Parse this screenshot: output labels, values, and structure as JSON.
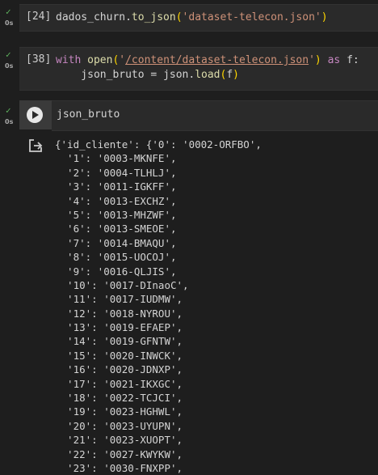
{
  "cells": [
    {
      "status": "✓",
      "time": "0s",
      "exec_count": "[24]",
      "code_lines": [
        [
          {
            "t": "dados_churn",
            "c": "plain"
          },
          {
            "t": ".",
            "c": "plain"
          },
          {
            "t": "to_json",
            "c": "fn"
          },
          {
            "t": "(",
            "c": "paren"
          },
          {
            "t": "'dataset-telecon.json'",
            "c": "str"
          },
          {
            "t": ")",
            "c": "paren"
          }
        ]
      ]
    },
    {
      "status": "✓",
      "time": "0s",
      "exec_count": "[38]",
      "code_lines": [
        [
          {
            "t": "with ",
            "c": "kw"
          },
          {
            "t": "open",
            "c": "fn"
          },
          {
            "t": "(",
            "c": "paren"
          },
          {
            "t": "'",
            "c": "str"
          },
          {
            "t": "/content/dataset-telecon.json",
            "c": "url"
          },
          {
            "t": "'",
            "c": "str"
          },
          {
            "t": ") ",
            "c": "paren"
          },
          {
            "t": "as ",
            "c": "kw"
          },
          {
            "t": "f:",
            "c": "plain"
          }
        ],
        [
          {
            "t": "    json_bruto ",
            "c": "plain"
          },
          {
            "t": "= ",
            "c": "plain"
          },
          {
            "t": "json",
            "c": "plain"
          },
          {
            "t": ".",
            "c": "plain"
          },
          {
            "t": "load",
            "c": "fn"
          },
          {
            "t": "(",
            "c": "paren"
          },
          {
            "t": "f",
            "c": "plain"
          },
          {
            "t": ")",
            "c": "paren"
          }
        ]
      ]
    },
    {
      "status": "✓",
      "time": "0s",
      "code": "json_bruto"
    }
  ],
  "output_lines": [
    "{'id_cliente': {'0': '0002-ORFBO',",
    "  '1': '0003-MKNFE',",
    "  '2': '0004-TLHLJ',",
    "  '3': '0011-IGKFF',",
    "  '4': '0013-EXCHZ',",
    "  '5': '0013-MHZWF',",
    "  '6': '0013-SMEOE',",
    "  '7': '0014-BMAQU',",
    "  '8': '0015-UOCOJ',",
    "  '9': '0016-QLJIS',",
    "  '10': '0017-DInaoC',",
    "  '11': '0017-IUDMW',",
    "  '12': '0018-NYROU',",
    "  '13': '0019-EFAEP',",
    "  '14': '0019-GFNTW',",
    "  '15': '0020-INWCK',",
    "  '16': '0020-JDNXP',",
    "  '17': '0021-IKXGC',",
    "  '18': '0022-TCJCI',",
    "  '19': '0023-HGHWL',",
    "  '20': '0023-UYUPN',",
    "  '21': '0023-XUOPT',",
    "  '22': '0027-KWYKW',",
    "  '23': '0030-FNXPP',"
  ]
}
